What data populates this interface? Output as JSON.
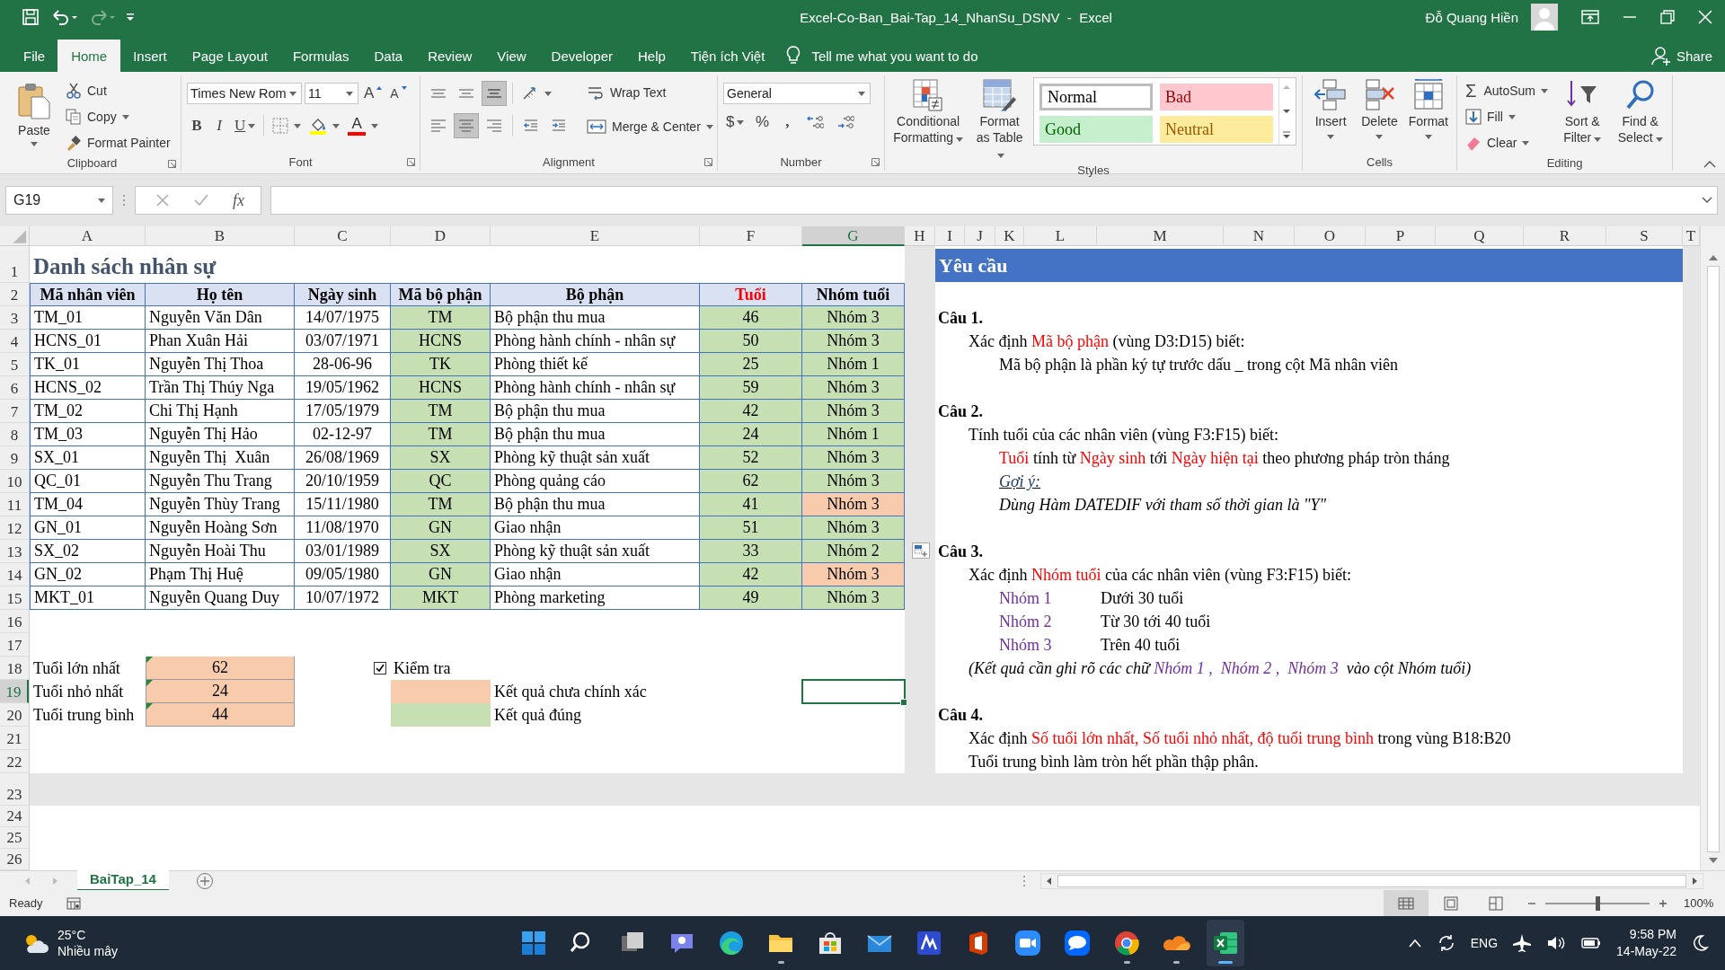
{
  "window": {
    "title": "Excel-Co-Ban_Bai-Tap_14_NhanSu_DSNV  -  Excel",
    "user": "Đỗ Quang Hiền"
  },
  "ribbon_tabs": [
    {
      "label": "File",
      "selected": false
    },
    {
      "label": "Home",
      "selected": true
    },
    {
      "label": "Insert",
      "selected": false
    },
    {
      "label": "Page Layout",
      "selected": false
    },
    {
      "label": "Formulas",
      "selected": false
    },
    {
      "label": "Data",
      "selected": false
    },
    {
      "label": "Review",
      "selected": false
    },
    {
      "label": "View",
      "selected": false
    },
    {
      "label": "Developer",
      "selected": false
    },
    {
      "label": "Help",
      "selected": false
    },
    {
      "label": "Tiện ích Việt",
      "selected": false
    }
  ],
  "tell_me": {
    "placeholder": "Tell me what you want to do"
  },
  "share": "Share",
  "clipboard": {
    "paste": "Paste",
    "cut": "Cut",
    "copy": "Copy",
    "format_painter": "Format Painter",
    "label": "Clipboard"
  },
  "font": {
    "name": "Times New Rom",
    "size": "11",
    "grow": "A",
    "shrink": "A",
    "bold": "B",
    "italic": "I",
    "underline": "U",
    "font_color": "A",
    "label": "Font"
  },
  "alignment": {
    "vertical": [
      {
        "kind": "top",
        "selected": false
      },
      {
        "kind": "middle",
        "selected": false
      },
      {
        "kind": "bottom",
        "selected": true
      }
    ],
    "horizontal": [
      {
        "kind": "left",
        "selected": false
      },
      {
        "kind": "center",
        "selected": true
      },
      {
        "kind": "right",
        "selected": false
      }
    ],
    "wrap_text": "Wrap Text",
    "merge": "Merge & Center",
    "label": "Alignment"
  },
  "number": {
    "format": "General",
    "currency": "$",
    "percent": "%",
    "comma": ",",
    "label": "Number"
  },
  "styles": {
    "conditional": "Conditional Formatting",
    "format_table": "Format as Table",
    "label": "Styles",
    "presets": [
      {
        "label": "Normal",
        "kind": "normal",
        "selected": true
      },
      {
        "label": "Bad",
        "kind": "bad",
        "selected": false
      },
      {
        "label": "Good",
        "kind": "good",
        "selected": false
      },
      {
        "label": "Neutral",
        "kind": "neutral",
        "selected": false
      }
    ]
  },
  "cells": {
    "insert": "Insert",
    "delete": "Delete",
    "format": "Format",
    "label": "Cells"
  },
  "editing": {
    "autosum_symbol": "Σ",
    "autosum": "AutoSum",
    "fill": "Fill",
    "clear": "Clear",
    "sort": "Sort & Filter",
    "find": "Find & Select",
    "label": "Editing"
  },
  "formula_bar": {
    "name_box": "G19",
    "fx": "fx"
  },
  "columns": [
    {
      "label": "A",
      "selected": false
    },
    {
      "label": "B",
      "selected": false
    },
    {
      "label": "C",
      "selected": false
    },
    {
      "label": "D",
      "selected": false
    },
    {
      "label": "E",
      "selected": false
    },
    {
      "label": "F",
      "selected": false
    },
    {
      "label": "G",
      "selected": true
    },
    {
      "label": "H",
      "selected": false
    },
    {
      "label": "I",
      "selected": false
    },
    {
      "label": "J",
      "selected": false
    },
    {
      "label": "K",
      "selected": false
    },
    {
      "label": "L",
      "selected": false
    },
    {
      "label": "M",
      "selected": false
    },
    {
      "label": "N",
      "selected": false
    },
    {
      "label": "O",
      "selected": false
    },
    {
      "label": "P",
      "selected": false
    },
    {
      "label": "Q",
      "selected": false
    },
    {
      "label": "R",
      "selected": false
    },
    {
      "label": "S",
      "selected": false
    },
    {
      "label": "T",
      "selected": false
    }
  ],
  "rows": [
    {
      "label": "1",
      "selected": false
    },
    {
      "label": "2",
      "selected": false
    },
    {
      "label": "3",
      "selected": false
    },
    {
      "label": "4",
      "selected": false
    },
    {
      "label": "5",
      "selected": false
    },
    {
      "label": "6",
      "selected": false
    },
    {
      "label": "7",
      "selected": false
    },
    {
      "label": "8",
      "selected": false
    },
    {
      "label": "9",
      "selected": false
    },
    {
      "label": "10",
      "selected": false
    },
    {
      "label": "11",
      "selected": false
    },
    {
      "label": "12",
      "selected": false
    },
    {
      "label": "13",
      "selected": false
    },
    {
      "label": "14",
      "selected": false
    },
    {
      "label": "15",
      "selected": false
    },
    {
      "label": "16",
      "selected": false
    },
    {
      "label": "17",
      "selected": false
    },
    {
      "label": "18",
      "selected": false
    },
    {
      "label": "19",
      "selected": true
    },
    {
      "label": "20",
      "selected": false
    },
    {
      "label": "21",
      "selected": false
    },
    {
      "label": "22",
      "selected": false
    },
    {
      "label": "23",
      "selected": false
    },
    {
      "label": "24",
      "selected": false
    },
    {
      "label": "25",
      "selected": false
    },
    {
      "label": "26",
      "selected": false
    }
  ],
  "sheet": {
    "title": "Danh sách nhân sự",
    "headers": [
      {
        "label": "Mã nhân viên",
        "color": "#000000"
      },
      {
        "label": "Họ tên",
        "color": "#000000"
      },
      {
        "label": "Ngày sinh",
        "color": "#000000"
      },
      {
        "label": "Mã bộ phận",
        "color": "#000000"
      },
      {
        "label": "Bộ phận",
        "color": "#000000"
      },
      {
        "label": "Tuổi",
        "color": "#ff0000"
      },
      {
        "label": "Nhóm tuổi",
        "color": "#000000"
      }
    ],
    "records": [
      {
        "cells": [
          "TM_01",
          "Nguyễn Văn Dân",
          "14/07/1975",
          "TM",
          "Bộ phận thu mua",
          "46",
          "Nhóm 3"
        ],
        "code_ok": true,
        "age_ok": true,
        "group_ok": true
      },
      {
        "cells": [
          "HCNS_01",
          "Phan Xuân Hải",
          "03/07/1971",
          "HCNS",
          "Phòng hành chính - nhân sự",
          "50",
          "Nhóm 3"
        ],
        "code_ok": true,
        "age_ok": true,
        "group_ok": true
      },
      {
        "cells": [
          "TK_01",
          "Nguyễn Thị Thoa",
          "28-06-96",
          "TK",
          "Phòng thiết kế",
          "25",
          "Nhóm 1"
        ],
        "code_ok": true,
        "age_ok": true,
        "group_ok": true
      },
      {
        "cells": [
          "HCNS_02",
          "Trần Thị Thúy Nga",
          "19/05/1962",
          "HCNS",
          "Phòng hành chính - nhân sự",
          "59",
          "Nhóm 3"
        ],
        "code_ok": true,
        "age_ok": true,
        "group_ok": true
      },
      {
        "cells": [
          "TM_02",
          "Chi Thị Hạnh",
          "17/05/1979",
          "TM",
          "Bộ phận thu mua",
          "42",
          "Nhóm 3"
        ],
        "code_ok": true,
        "age_ok": true,
        "group_ok": true
      },
      {
        "cells": [
          "TM_03",
          "Nguyễn Thị Hảo",
          "02-12-97",
          "TM",
          "Bộ phận thu mua",
          "24",
          "Nhóm 1"
        ],
        "code_ok": true,
        "age_ok": true,
        "group_ok": true
      },
      {
        "cells": [
          "SX_01",
          "Nguyễn Thị  Xuân",
          "26/08/1969",
          "SX",
          "Phòng kỹ thuật sản xuất",
          "52",
          "Nhóm 3"
        ],
        "code_ok": true,
        "age_ok": true,
        "group_ok": true
      },
      {
        "cells": [
          "QC_01",
          "Nguyễn Thu Trang",
          "20/10/1959",
          "QC",
          "Phòng quảng cáo",
          "62",
          "Nhóm 3"
        ],
        "code_ok": true,
        "age_ok": true,
        "group_ok": true
      },
      {
        "cells": [
          "TM_04",
          "Nguyễn Thùy Trang",
          "15/11/1980",
          "TM",
          "Bộ phận thu mua",
          "41",
          "Nhóm 3"
        ],
        "code_ok": true,
        "age_ok": true,
        "group_ok": false
      },
      {
        "cells": [
          "GN_01",
          "Nguyễn Hoàng Sơn",
          "11/08/1970",
          "GN",
          "Giao nhận",
          "51",
          "Nhóm 3"
        ],
        "code_ok": true,
        "age_ok": true,
        "group_ok": true
      },
      {
        "cells": [
          "SX_02",
          "Nguyễn Hoài Thu",
          "03/01/1989",
          "SX",
          "Phòng kỹ thuật sản xuất",
          "33",
          "Nhóm 2"
        ],
        "code_ok": true,
        "age_ok": true,
        "group_ok": true
      },
      {
        "cells": [
          "GN_02",
          "Phạm Thị Huệ",
          "09/05/1980",
          "GN",
          "Giao nhận",
          "42",
          "Nhóm 3"
        ],
        "code_ok": true,
        "age_ok": true,
        "group_ok": false
      },
      {
        "cells": [
          "MKT_01",
          "Nguyễn Quang Duy",
          "10/07/1972",
          "MKT",
          "Phòng marketing",
          "49",
          "Nhóm 3"
        ],
        "code_ok": true,
        "age_ok": true,
        "group_ok": true
      }
    ],
    "summary": [
      {
        "label": "Tuổi lớn nhất",
        "value": "62",
        "ok": false
      },
      {
        "label": "Tuổi nhỏ nhất",
        "value": "24",
        "ok": false
      },
      {
        "label": "Tuổi trung bình",
        "value": "44",
        "ok": false
      }
    ],
    "check": {
      "label": "Kiểm tra",
      "checked": true
    },
    "legend": [
      {
        "label": "Kết quả chưa chính xác",
        "ok": false
      },
      {
        "label": "Kết quả đúng",
        "ok": true
      }
    ]
  },
  "requirements": {
    "title": "Yêu cầu",
    "questions": [
      {
        "heading": "Câu 1.",
        "items": [
          {
            "kind": "text",
            "segments": [
              {
                "text": "Xác định ",
                "color": "#000000"
              },
              {
                "text": "Mã bộ phận",
                "color": "#ff0000"
              },
              {
                "text": " (vùng D3:D15) biết:",
                "color": "#000000"
              }
            ],
            "children": [
              {
                "kind": "text",
                "segments": [
                  {
                    "text": "Mã bộ phận là phần ký tự trước dấu _ trong cột Mã nhân viên",
                    "color": "#000000"
                  }
                ]
              }
            ]
          }
        ]
      },
      {
        "heading": "Câu 2.",
        "items": [
          {
            "kind": "text",
            "segments": [
              {
                "text": "Tính tuổi của các nhân viên (vùng F3:F15) biết:",
                "color": "#000000"
              }
            ],
            "children": [
              {
                "kind": "text",
                "segments": [
                  {
                    "text": "Tuổi",
                    "color": "#ff0000"
                  },
                  {
                    "text": " tính từ ",
                    "color": "#000000"
                  },
                  {
                    "text": "Ngày sinh",
                    "color": "#ff0000"
                  },
                  {
                    "text": " tới ",
                    "color": "#000000"
                  },
                  {
                    "text": "Ngày hiện tại",
                    "color": "#ff0000"
                  },
                  {
                    "text": " theo phương pháp tròn tháng",
                    "color": "#000000"
                  }
                ]
              },
              {
                "kind": "hint",
                "segments": [
                  {
                    "text": "Gợi ý:",
                    "color": "#1f3864"
                  }
                ]
              },
              {
                "kind": "note",
                "segments": [
                  {
                    "text": "Dùng Hàm DATEDIF với tham số thời gian là \"Y\"",
                    "color": "#000000"
                  }
                ]
              }
            ]
          }
        ]
      },
      {
        "heading": "Câu 3.",
        "items": [
          {
            "kind": "text",
            "segments": [
              {
                "text": "Xác định ",
                "color": "#000000"
              },
              {
                "text": "Nhóm tuổi",
                "color": "#ff0000"
              },
              {
                "text": " của các nhân viên (vùng F3:F15) biết:",
                "color": "#000000"
              }
            ],
            "children": [
              {
                "kind": "pair",
                "term": "Nhóm 1",
                "color": "#7030a0",
                "description": "Dưới 30 tuổi"
              },
              {
                "kind": "pair",
                "term": "Nhóm 2",
                "color": "#7030a0",
                "description": "Từ 30 tới 40 tuổi"
              },
              {
                "kind": "pair",
                "term": "Nhóm 3",
                "color": "#7030a0",
                "description": "Trên 40 tuổi"
              }
            ]
          },
          {
            "kind": "note",
            "segments": [
              {
                "text": "(Kết quả cần ghi rõ các chữ ",
                "color": "#000000"
              },
              {
                "text": "Nhóm 1 ,  Nhóm 2 ,  ",
                "color": "#7030a0"
              },
              {
                "text": "Nhóm 3",
                "color": "#7030a0"
              },
              {
                "text": "  vào cột Nhóm tuổi)",
                "color": "#000000"
              }
            ]
          }
        ]
      },
      {
        "heading": "Câu 4.",
        "items": [
          {
            "kind": "text",
            "segments": [
              {
                "text": "Xác định ",
                "color": "#000000"
              },
              {
                "text": "Số tuổi lớn nhất, Số tuổi nhỏ nhất, độ tuổi trung bình",
                "color": "#ff0000"
              },
              {
                "text": " trong vùng B18:B20",
                "color": "#000000"
              }
            ]
          },
          {
            "kind": "text",
            "segments": [
              {
                "text": "Tuổi trung bình làm tròn hết phần thập phân.",
                "color": "#000000"
              }
            ]
          }
        ]
      }
    ]
  },
  "sheet_tabs": [
    {
      "label": "BaiTap_14",
      "selected": true
    }
  ],
  "status_bar": {
    "status": "Ready",
    "views": [
      {
        "kind": "normal",
        "selected": true
      },
      {
        "kind": "page_layout",
        "selected": false
      },
      {
        "kind": "page_break",
        "selected": false
      }
    ],
    "zoom_slider": {
      "level": 0.5
    },
    "zoom": "100%"
  },
  "taskbar": {
    "weather": {
      "temperature": "25°C",
      "condition": "Nhiều mây"
    },
    "apps": [
      {
        "kind": "start",
        "running": false,
        "selected": false
      },
      {
        "kind": "search",
        "running": false,
        "selected": false
      },
      {
        "kind": "task_view",
        "running": false,
        "selected": false
      },
      {
        "kind": "chat",
        "running": false,
        "selected": false
      },
      {
        "kind": "edge",
        "running": false,
        "selected": false
      },
      {
        "kind": "explorer",
        "running": true,
        "selected": false
      },
      {
        "kind": "store",
        "running": false,
        "selected": false
      },
      {
        "kind": "mail",
        "running": false,
        "selected": false
      },
      {
        "kind": "blue_app",
        "running": false,
        "selected": false
      },
      {
        "kind": "office",
        "running": false,
        "selected": false
      },
      {
        "kind": "zoom",
        "running": false,
        "selected": false
      },
      {
        "kind": "zalo",
        "running": false,
        "selected": false
      },
      {
        "kind": "chrome",
        "running": true,
        "selected": false
      },
      {
        "kind": "cloud",
        "running": true,
        "selected": false
      },
      {
        "kind": "excel",
        "running": true,
        "selected": true
      }
    ],
    "language": "ENG",
    "time": "9:58 PM",
    "date": "14-May-22"
  }
}
